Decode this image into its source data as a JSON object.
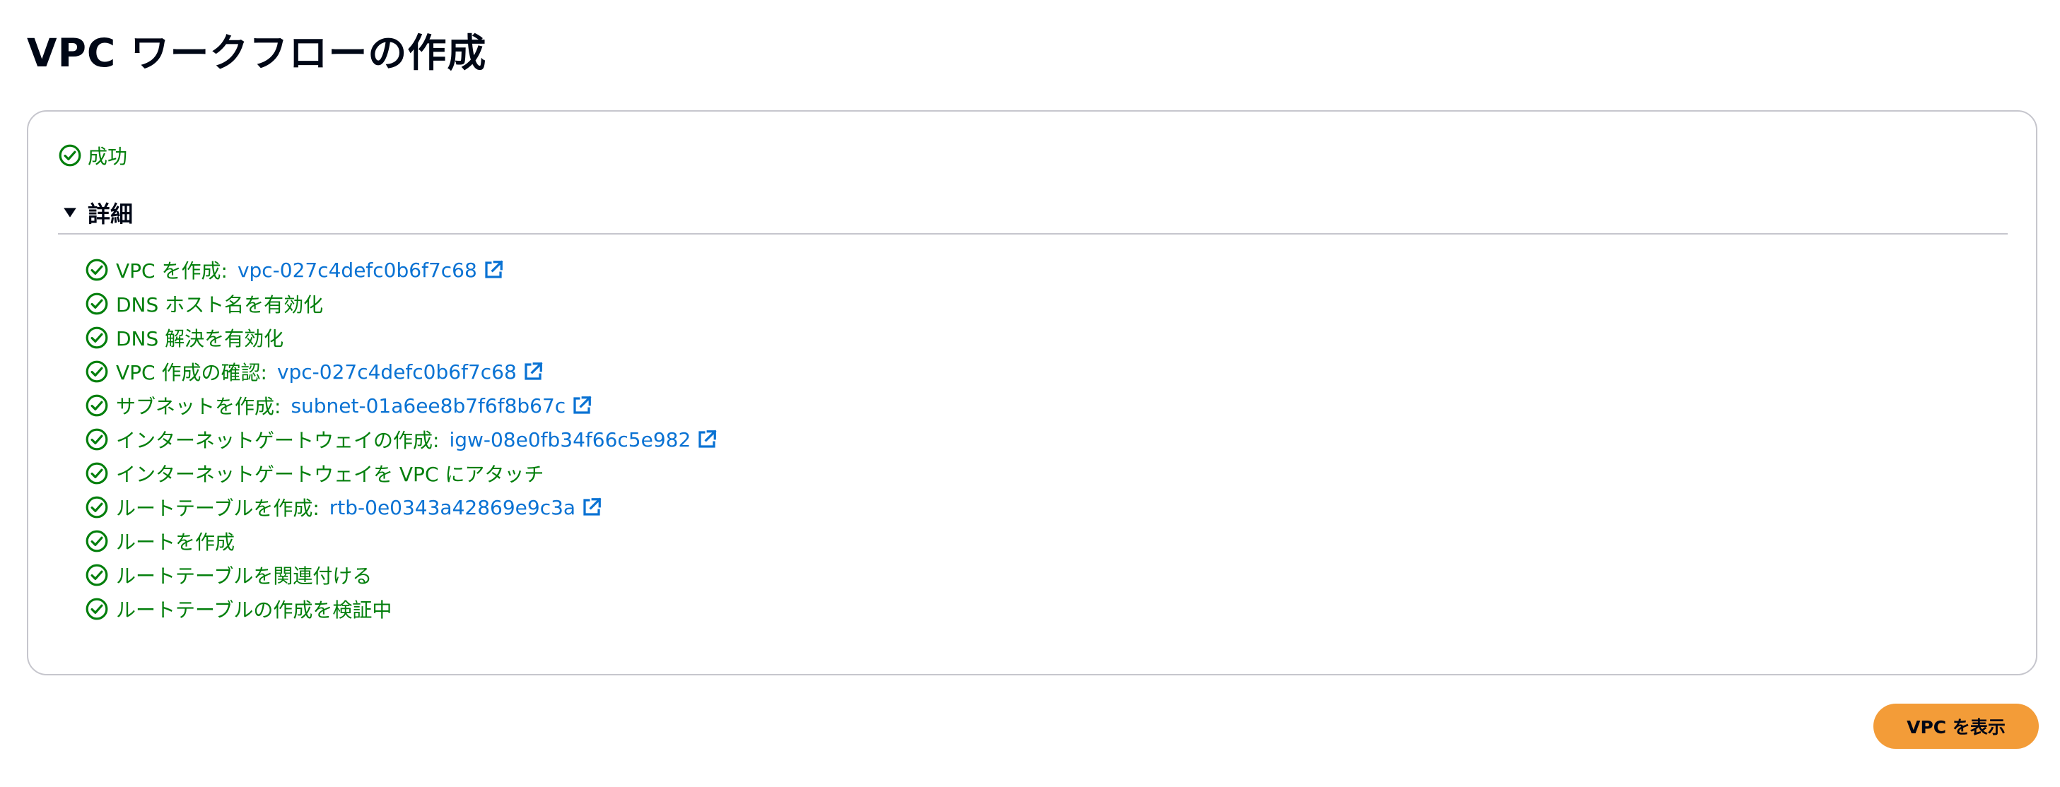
{
  "page": {
    "title": "VPC ワークフローの作成"
  },
  "status": {
    "icon": "check-circle-icon",
    "label": "成功",
    "color": "#037f0c"
  },
  "details": {
    "label": "詳細",
    "expanded": true,
    "toggle_icon": "caret-down-icon"
  },
  "steps": [
    {
      "label": "VPC を作成:",
      "link": "vpc-027c4defc0b6f7c68",
      "external": true
    },
    {
      "label": "DNS ホスト名を有効化"
    },
    {
      "label": "DNS 解決を有効化"
    },
    {
      "label": "VPC 作成の確認:",
      "link": "vpc-027c4defc0b6f7c68",
      "external": true
    },
    {
      "label": "サブネットを作成:",
      "link": "subnet-01a6ee8b7f6f8b67c",
      "external": true
    },
    {
      "label": "インターネットゲートウェイの作成:",
      "link": "igw-08e0fb34f66c5e982",
      "external": true
    },
    {
      "label": "インターネットゲートウェイを VPC にアタッチ"
    },
    {
      "label": "ルートテーブルを作成:",
      "link": "rtb-0e0343a42869e9c3a",
      "external": true
    },
    {
      "label": "ルートを作成"
    },
    {
      "label": "ルートテーブルを関連付ける"
    },
    {
      "label": "ルートテーブルの作成を検証中"
    }
  ],
  "actions": {
    "view_vpc_label": "VPC を表示"
  },
  "colors": {
    "success": "#037f0c",
    "link": "#0972d3",
    "primary_button": "#f39c38"
  }
}
